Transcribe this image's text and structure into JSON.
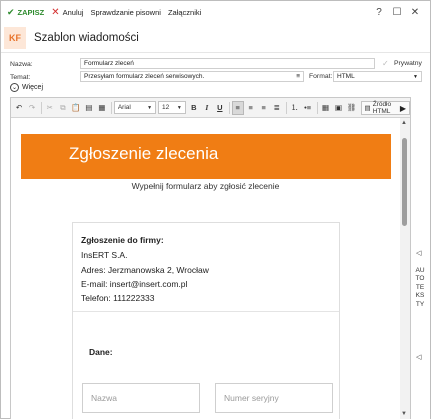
{
  "toolbar": {
    "save_label": "ZAPISZ",
    "cancel_label": "Anuluj",
    "spellcheck_label": "Sprawdzanie pisowni",
    "attachments_label": "Załączniki"
  },
  "window_controls": {
    "help": "?",
    "maximize": "☐",
    "close": "✕"
  },
  "header": {
    "badge": "KF",
    "title": "Szablon wiadomości"
  },
  "form": {
    "name_label": "Nazwa:",
    "name_value": "Formularz zleceń",
    "private_label": "Prywatny",
    "subject_label": "Temat:",
    "subject_value": "Przesyłam formularz zleceń serwisowych.",
    "format_label": "Format:",
    "format_value": "HTML",
    "more_label": "Więcej"
  },
  "editor_toolbar": {
    "font": "Arial",
    "size": "12",
    "bold": "B",
    "italic": "I",
    "underline": "U",
    "source_label": "Źródło HTML"
  },
  "content": {
    "banner_title": "Zgłoszenie zlecenia",
    "subtitle": "Wypełnij formularz aby zgłosić zlecenie",
    "company_heading": "Zgłoszenie do firmy:",
    "company_name": "InsERT S.A.",
    "address": "Adres: Jerzmanowska 2, Wrocław",
    "email": "E-mail: insert@insert.com.pl",
    "phone": "Telefon: 111222333",
    "data_heading": "Dane:",
    "name_placeholder": "Nazwa",
    "serial_placeholder": "Numer seryjny"
  },
  "side_panel": {
    "label": "AUTOTEKSTY"
  },
  "colors": {
    "banner": "#f07d14",
    "save": "#2e8b2e",
    "cancel": "#d32f2f",
    "badge_bg": "#fde7d8",
    "badge_fg": "#e8742c"
  }
}
